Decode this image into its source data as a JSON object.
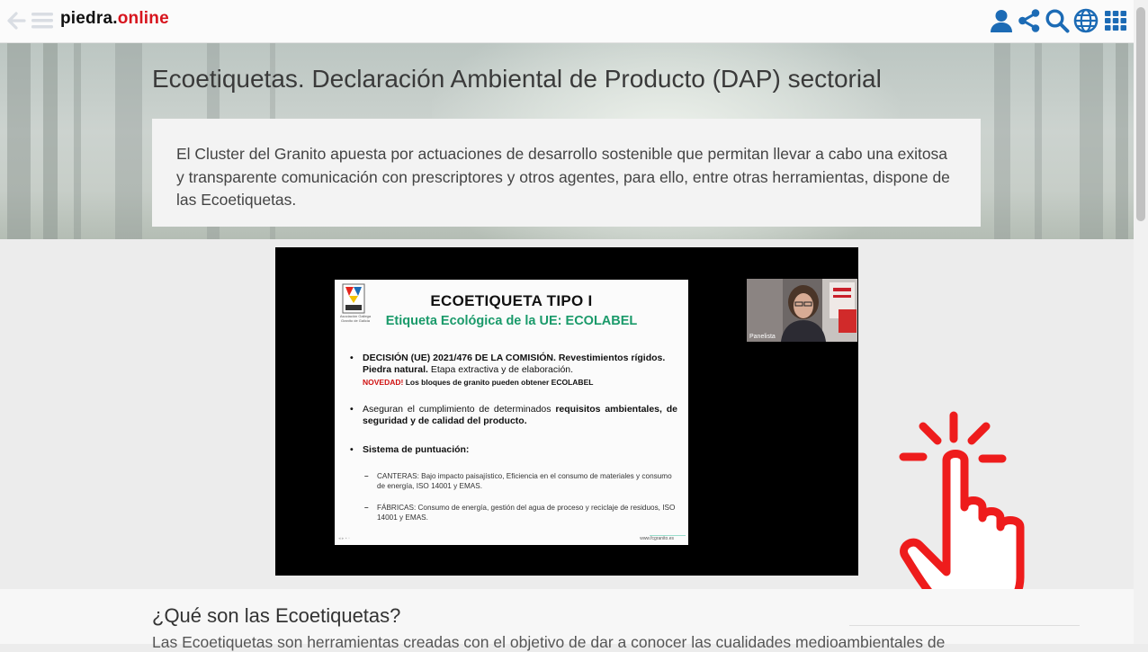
{
  "site": {
    "logo_part1": "piedra",
    "logo_dot": ".",
    "logo_part2": "online",
    "brand_color": "#d7141d",
    "icon_color": "#1c6bb5"
  },
  "topbar": {
    "left_icons": [
      "arrow-left-icon",
      "hamburger-menu-icon"
    ],
    "right_icons": [
      "user-icon",
      "share-icon",
      "search-icon",
      "globe-icon",
      "grid-apps-icon"
    ]
  },
  "hero": {
    "title": "Ecoetiquetas. Declaración Ambiental de Producto (DAP) sectorial",
    "intro": "El Cluster del Granito apuesta por actuaciones de desarrollo sostenible que permitan llevar a cabo una exitosa y transparente comunicación con prescriptores y otros agentes, para ello, entre otras herramientas, dispone de las Ecoetiquetas."
  },
  "video": {
    "slide": {
      "logo_sub": "Asociación Gallega Granito de Galicia",
      "title": "ECOETIQUETA TIPO I",
      "subtitle": "Etiqueta Ecológica de la UE: ECOLABEL",
      "bullet1_bold": "DECISIÓN (UE) 2021/476 DE LA COMISIÓN. Revestimientos rígidos. Piedra natural.",
      "bullet1_rest": " Etapa extractiva y de elaboración.",
      "novedad_label": "NOVEDAD!",
      "novedad_text": " Los bloques de granito pueden obtener ECOLABEL",
      "bullet2_plain": "Aseguran el cumplimiento de determinados ",
      "bullet2_bold": "requisitos ambientales, de seguridad y de calidad del producto.",
      "bullet3": "Sistema de puntuación:",
      "sub1": "CANTERAS: Bajo impacto paisajístico, Eficiencia en el consumo de materiales y consumo de energía, ISO 14001 y EMAS.",
      "sub2": "FÁBRICAS: Consumo de energía, gestión del agua de proceso y reciclaje de residuos, ISO 14001 y EMAS.",
      "url": "www.fcgranito.es"
    },
    "camera_label": "Panelista"
  },
  "section": {
    "heading": "¿Qué son las Ecoetiquetas?",
    "text": "Las Ecoetiquetas son herramientas creadas con el objetivo de dar a conocer las cualidades medioambientales de"
  }
}
